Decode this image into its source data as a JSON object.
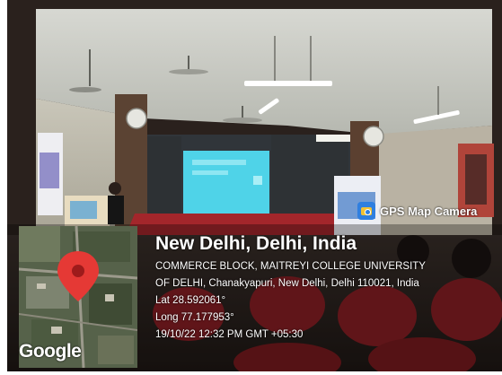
{
  "stamp": {
    "app_name": "GPS Map Camera",
    "app_icon": "gps-map-camera-icon",
    "location_title": "New Delhi, Delhi, India",
    "address_line_1": "COMMERCE BLOCK, MAITREYI COLLEGE UNIVERSITY",
    "address_line_2": "OF DELHI, Chanakyapuri, New Delhi, Delhi 110021, India",
    "latitude": "Lat 28.592061°",
    "longitude": "Long 77.177953°",
    "timestamp": "19/10/22 12:32 PM GMT +05:30"
  },
  "map": {
    "attribution": "Google",
    "marker_icon": "map-pin-icon",
    "marker_color": "#e53935"
  },
  "scene": {
    "screen_color": "#4fd3e8",
    "stage_color": "#a3262b",
    "chair_color": "#8a1f24"
  }
}
